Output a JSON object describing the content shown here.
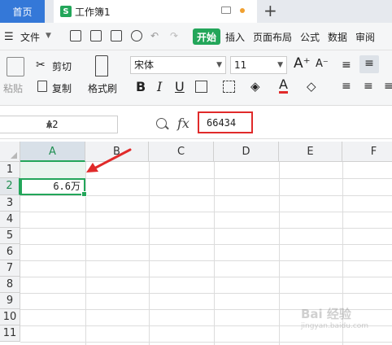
{
  "tabs": {
    "home": "首页",
    "doc": "工作簿1",
    "doc_logo": "S"
  },
  "menu": {
    "file": "文件",
    "items": [
      "开始",
      "插入",
      "页面布局",
      "公式",
      "数据",
      "审阅"
    ]
  },
  "ribbon": {
    "paste": "粘贴",
    "cut": "剪切",
    "copy": "复制",
    "format_painter": "格式刷",
    "font_name": "宋体",
    "font_size": "11",
    "bold": "B",
    "italic": "I",
    "underline": "U"
  },
  "formula_bar": {
    "name_box": "A2",
    "fx": "fx",
    "value": "66434"
  },
  "sheet": {
    "columns": [
      "A",
      "B",
      "C",
      "D",
      "E",
      "F"
    ],
    "rows": [
      "1",
      "2",
      "3",
      "4",
      "5",
      "6",
      "7",
      "8",
      "9",
      "10",
      "11"
    ],
    "selected_column": "A",
    "selected_row": "2",
    "cell_a2": "6.6万"
  },
  "colors": {
    "accent_green": "#23a65a",
    "home_tab_blue": "#3478d8",
    "annotation_red": "#e02a2a"
  },
  "watermark": {
    "main": "Bai 经验",
    "sub": "jingyan.baidu.com"
  }
}
